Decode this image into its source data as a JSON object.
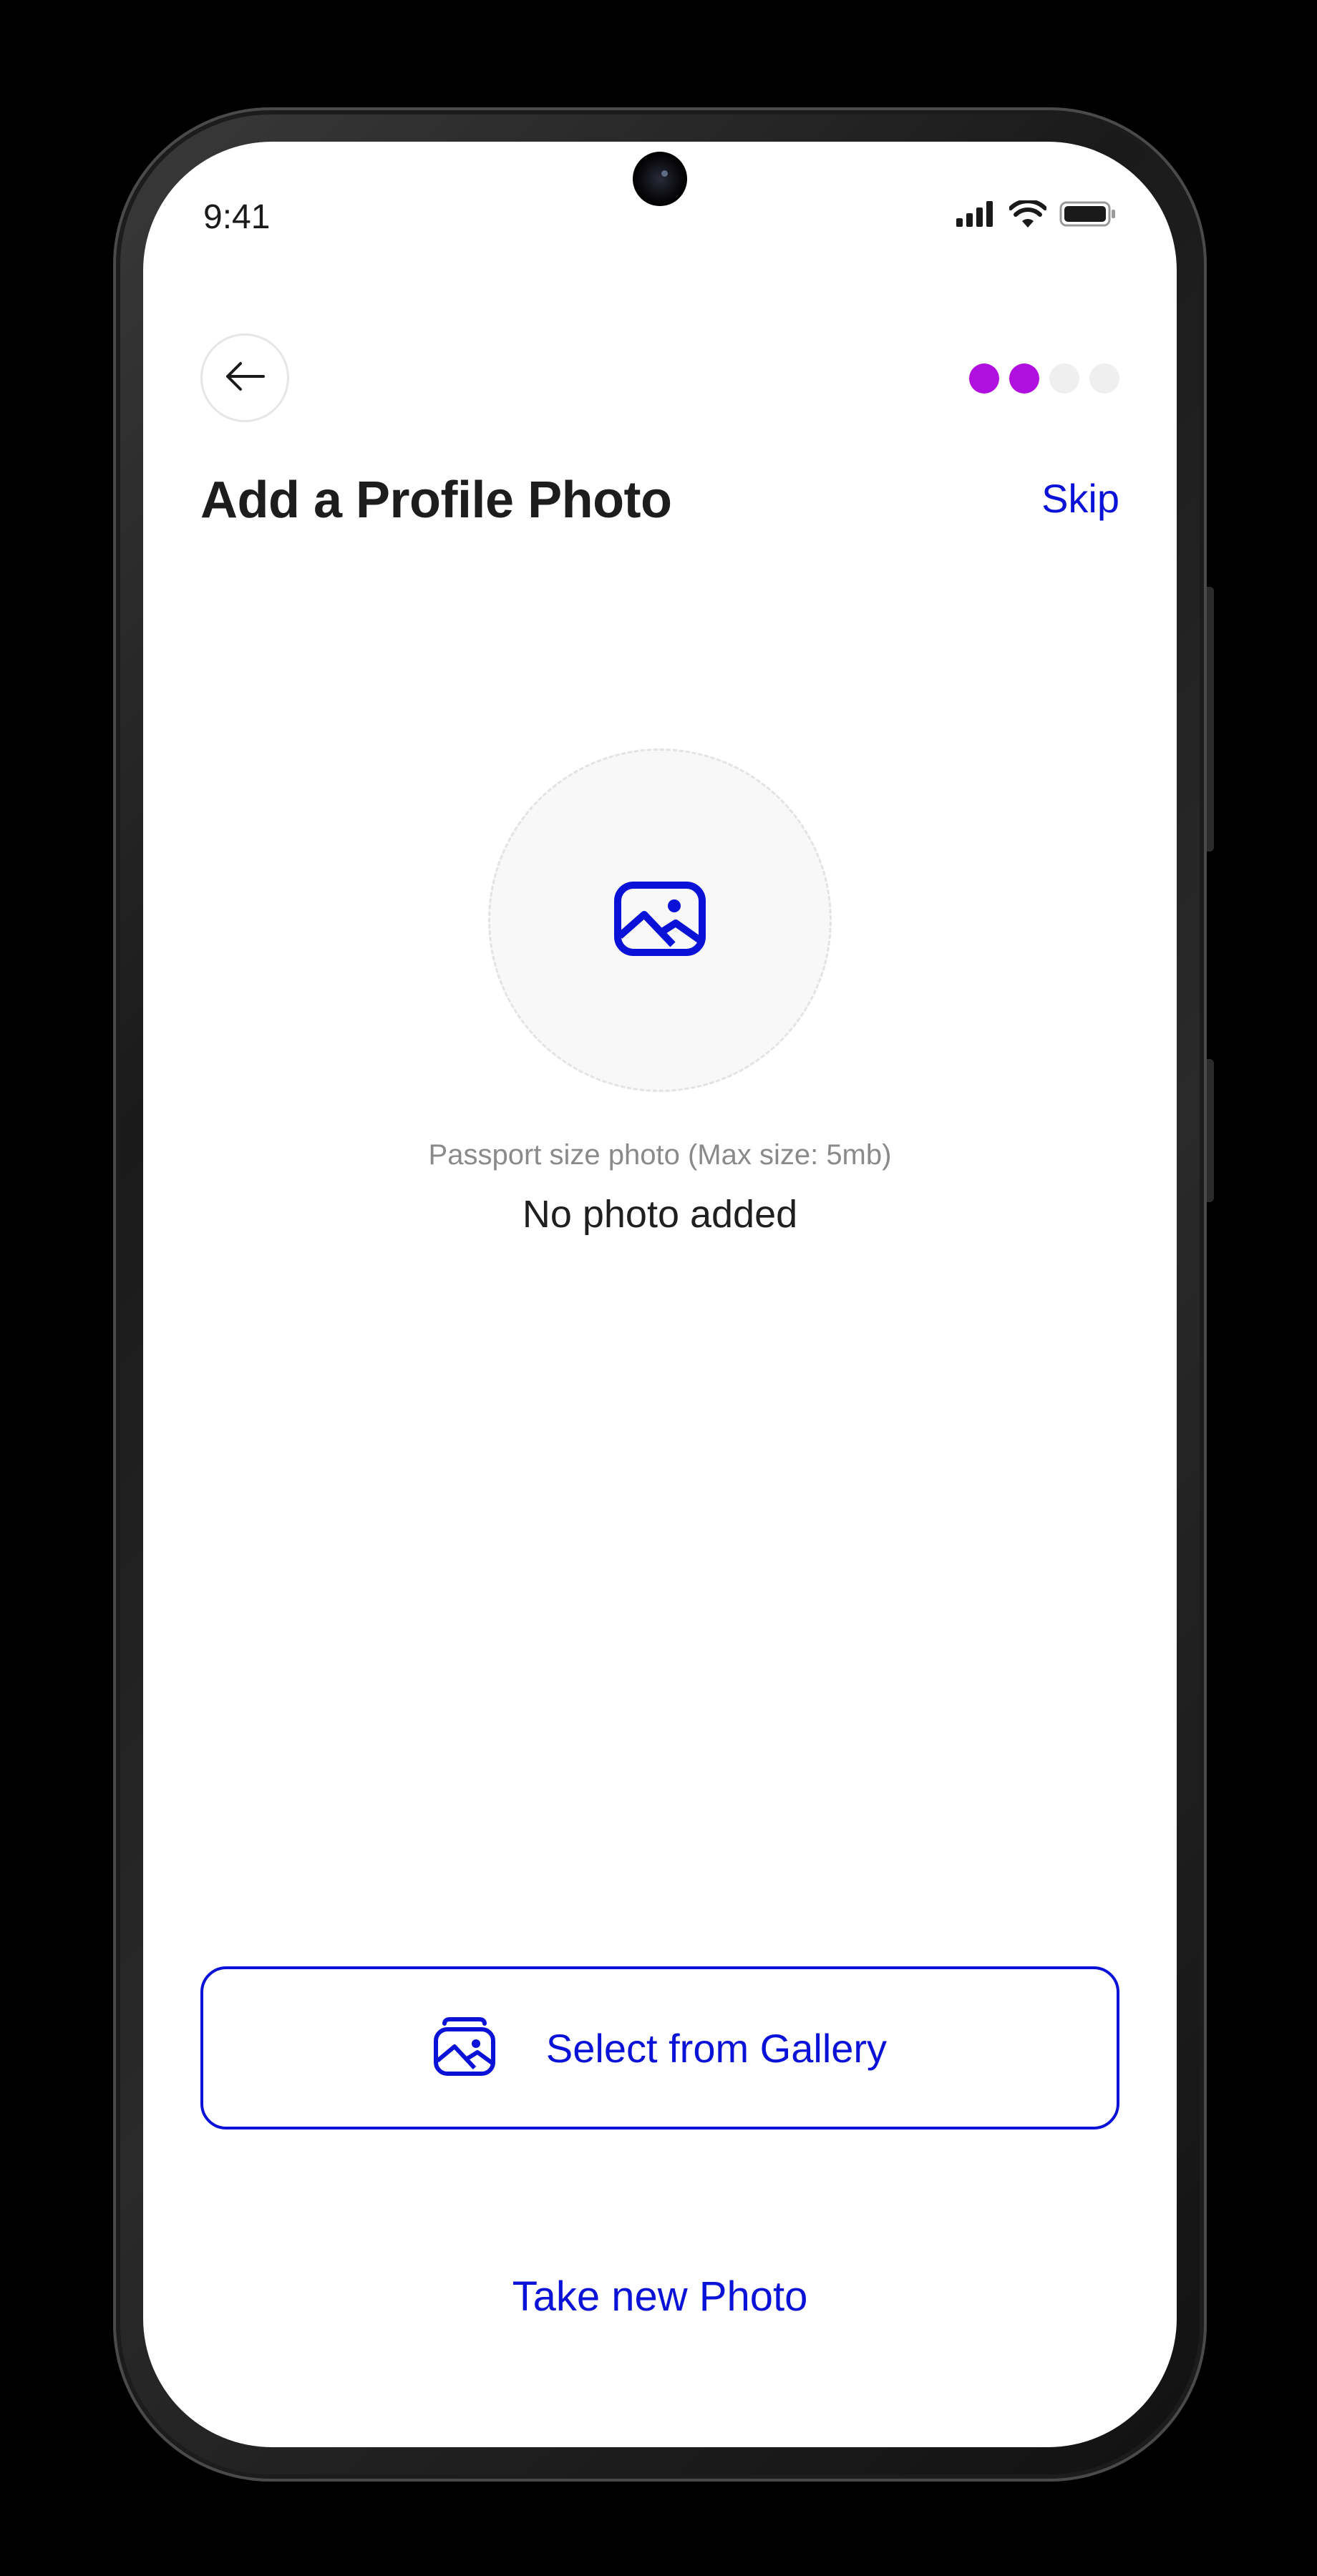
{
  "status_bar": {
    "time": "9:41",
    "signal_icon": "signal-icon",
    "wifi_icon": "wifi-icon",
    "battery_icon": "battery-icon"
  },
  "header": {
    "back_icon": "arrow-left-icon",
    "progress": {
      "total_steps": 4,
      "completed_steps": 2
    },
    "title": "Add a Profile Photo",
    "skip_label": "Skip"
  },
  "photo": {
    "placeholder_icon": "image-icon",
    "hint": "Passport size photo (Max size: 5mb)",
    "status": "No photo added"
  },
  "actions": {
    "gallery_label": "Select from Gallery",
    "gallery_icon": "gallery-icon",
    "take_photo_label": "Take new Photo"
  },
  "colors": {
    "accent": "#0a12d8",
    "progress_active": "#b10ee0",
    "progress_inactive": "#efefef"
  }
}
